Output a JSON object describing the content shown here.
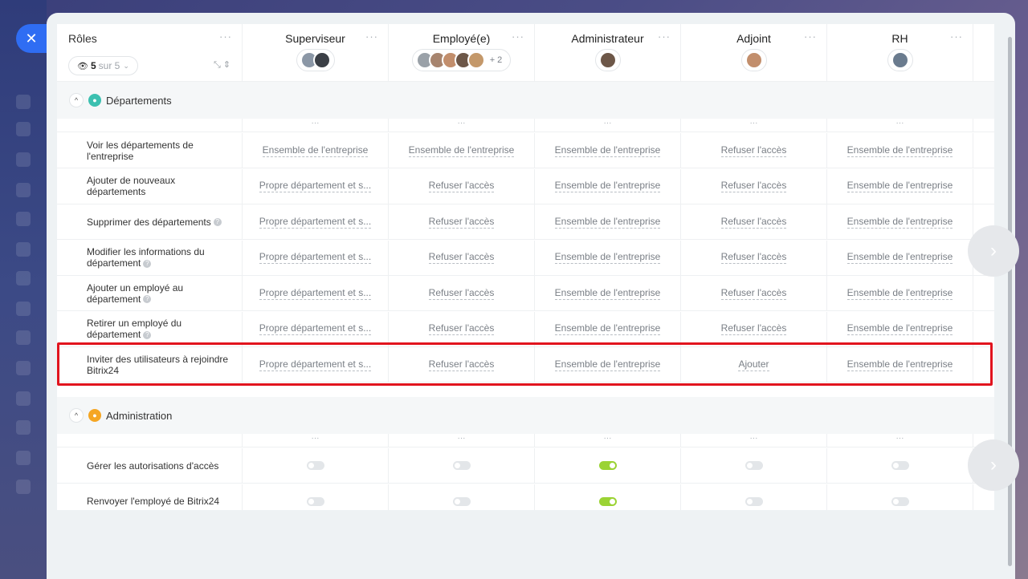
{
  "close_label": "✕",
  "header": {
    "first_title": "Rôles",
    "filter": {
      "count": "5",
      "of": "sur 5"
    },
    "roles": [
      {
        "name": "Superviseur",
        "extra": ""
      },
      {
        "name": "Employé(e)",
        "extra": "+ 2"
      },
      {
        "name": "Administrateur",
        "extra": ""
      },
      {
        "name": "Adjoint",
        "extra": ""
      },
      {
        "name": "RH",
        "extra": ""
      }
    ]
  },
  "sections": [
    {
      "label": "Départements"
    },
    {
      "label": "Administration"
    }
  ],
  "dep_rows": [
    {
      "label": "Voir les départements de l'entreprise",
      "help": false,
      "values": [
        "Ensemble de l'entreprise",
        "Ensemble de l'entreprise",
        "Ensemble de l'entreprise",
        "Refuser l'accès",
        "Ensemble de l'entreprise"
      ]
    },
    {
      "label": "Ajouter de nouveaux départements",
      "help": false,
      "values": [
        "Propre département et s...",
        "Refuser l'accès",
        "Ensemble de l'entreprise",
        "Refuser l'accès",
        "Ensemble de l'entreprise"
      ]
    },
    {
      "label": "Supprimer des départements",
      "help": true,
      "values": [
        "Propre département et s...",
        "Refuser l'accès",
        "Ensemble de l'entreprise",
        "Refuser l'accès",
        "Ensemble de l'entreprise"
      ]
    },
    {
      "label": "Modifier les informations du département",
      "help": true,
      "values": [
        "Propre département et s...",
        "Refuser l'accès",
        "Ensemble de l'entreprise",
        "Refuser l'accès",
        "Ensemble de l'entreprise"
      ]
    },
    {
      "label": "Ajouter un employé au département",
      "help": true,
      "values": [
        "Propre département et s...",
        "Refuser l'accès",
        "Ensemble de l'entreprise",
        "Refuser l'accès",
        "Ensemble de l'entreprise"
      ]
    },
    {
      "label": "Retirer un employé du département",
      "help": true,
      "values": [
        "Propre département et s...",
        "Refuser l'accès",
        "Ensemble de l'entreprise",
        "Refuser l'accès",
        "Ensemble de l'entreprise"
      ]
    },
    {
      "label": "Inviter des utilisateurs à rejoindre Bitrix24",
      "help": false,
      "values": [
        "Propre département et s...",
        "Refuser l'accès",
        "Ensemble de l'entreprise",
        "Ajouter",
        "Ensemble de l'entreprise"
      ]
    }
  ],
  "admin_rows": [
    {
      "label": "Gérer les autorisations d'accès",
      "toggles": [
        false,
        false,
        true,
        false,
        false
      ]
    },
    {
      "label": "Renvoyer l'employé de Bitrix24",
      "toggles": [
        false,
        false,
        true,
        false,
        false
      ]
    }
  ],
  "colors": {
    "accent": "#2f6df3",
    "toggle_on": "#9bd334",
    "highlight": "#e1141e"
  }
}
